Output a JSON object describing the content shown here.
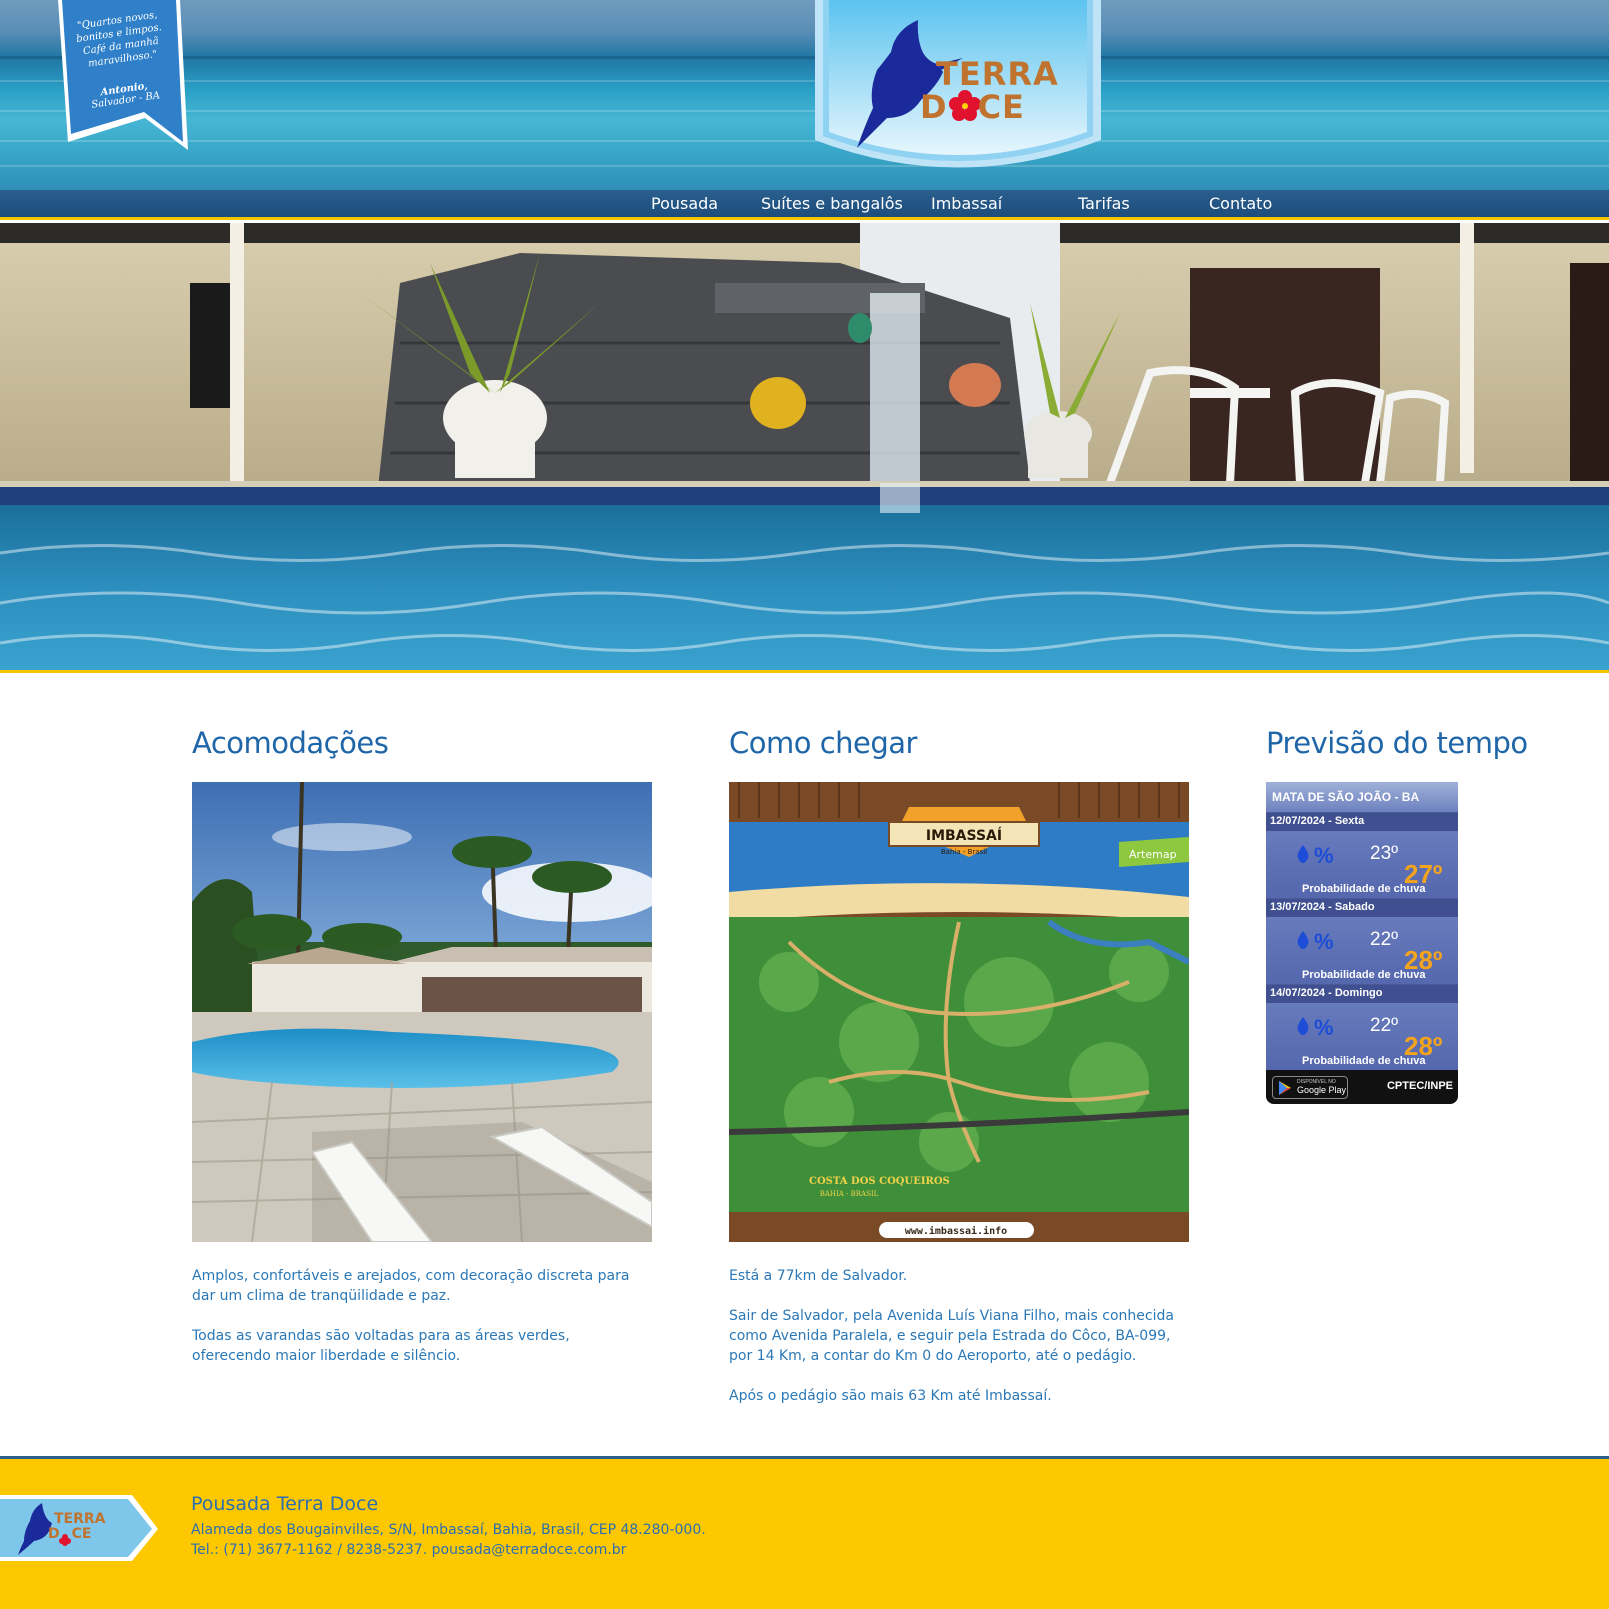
{
  "header": {
    "testimonial": {
      "quote": "\"Quartos novos, bonitos e limpos. Café da manhã maravilhoso.\"",
      "author": "Antonio,",
      "location": "Salvador - BA"
    },
    "logo": {
      "line1": "TERRA",
      "line2_start": "D",
      "line2_end": "CE",
      "flower_icon": "hibiscus-flower-icon",
      "bird_icon": "hummingbird-icon"
    }
  },
  "nav": {
    "items": [
      {
        "label": "Pousada"
      },
      {
        "label": "Suítes e bangalôs"
      },
      {
        "label": "Imbassaí"
      },
      {
        "label": "Tarifas"
      },
      {
        "label": "Contato"
      }
    ]
  },
  "accommodations": {
    "title": "Acomodações",
    "paragraphs": [
      "Amplos, confortáveis e arejados, com decoração discreta para dar um clima de tranqüilidade e paz.",
      "Todas as varandas são voltadas para as áreas verdes, oferecendo maior liberdade e silêncio."
    ]
  },
  "directions": {
    "title": "Como chegar",
    "map": {
      "banner": "IMBASSAÍ",
      "sub": "Bahia - Brasil",
      "region": "COSTA DOS COQUEIROS",
      "region_sub": "BAHIA - BRASIL",
      "url": "www.imbassai.info",
      "brand": "Artemap"
    },
    "paragraphs": [
      "Está a 77km de Salvador.",
      "Sair de Salvador, pela Avenida Luís Viana Filho, mais conhecida como Avenida Paralela, e seguir pela Estrada do Côco, BA-099, por 14 Km, a contar do Km 0 do Aeroporto, até o pedágio.",
      "Após o pedágio são mais 63 Km até Imbassaí."
    ]
  },
  "weather": {
    "title": "Previsão do tempo",
    "location": "MATA DE SÃO JOÃO - BA",
    "days": [
      {
        "date": "12/07/2024 - Sexta",
        "pct": "%",
        "min": "23º",
        "max": "27º",
        "label": "Probabilidade de chuva"
      },
      {
        "date": "13/07/2024 - Sabado",
        "pct": "%",
        "min": "22º",
        "max": "28º",
        "label": "Probabilidade de chuva"
      },
      {
        "date": "14/07/2024 - Domingo",
        "pct": "%",
        "min": "22º",
        "max": "28º",
        "label": "Probabilidade de chuva"
      }
    ],
    "store_small": "DISPONÍVEL NO",
    "store_big": "Google Play",
    "provider": "CPTEC/INPE"
  },
  "footer": {
    "logo_line1": "TERRA",
    "logo_line2_start": "D",
    "logo_line2_end": "CE",
    "name": "Pousada Terra Doce",
    "address": "Alameda dos Bougainvilles, S/N, Imbassaí, Bahia, Brasil, CEP 48.280-000.",
    "contact": "Tel.: (71) 3677-1162 / 8238-5237. pousada@terradoce.com.br"
  },
  "colors": {
    "accent_blue": "#1f66a9",
    "gold": "#fec800",
    "nav_blue": "#2a5f8e"
  }
}
